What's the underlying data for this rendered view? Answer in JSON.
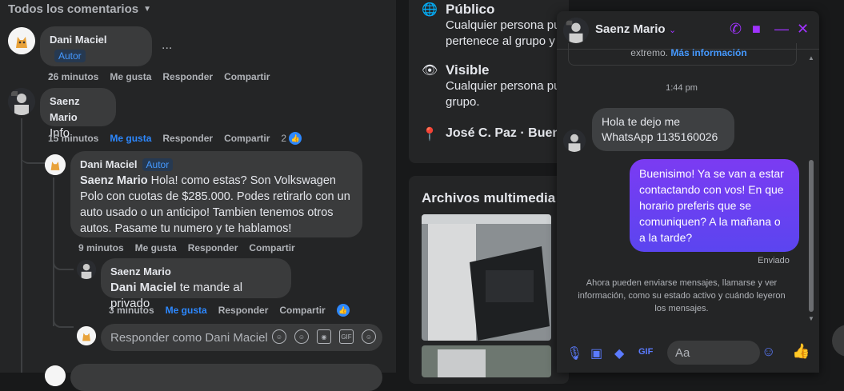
{
  "left": {
    "sort_label": "Todos los comentarios",
    "comments": [
      {
        "author": "Dani Maciel",
        "badge": "Autor",
        "text": ".",
        "time": "26 minutos",
        "like": "Me gusta",
        "reply": "Responder",
        "share": "Compartir"
      },
      {
        "author": "Saenz Mario",
        "text": "Info",
        "time": "15 minutos",
        "like": "Me gusta",
        "reply": "Responder",
        "share": "Compartir",
        "like_count": "2"
      },
      {
        "author": "Dani Maciel",
        "badge": "Autor",
        "mention": "Saenz Mario",
        "text": " Hola! como estas? Son Volkswagen Polo con cuotas de $285.000. Podes retirarlo con un auto usado o un anticipo! Tambien tenemos otros autos. Pasame tu numero y te hablamos!",
        "time": "9 minutos",
        "like": "Me gusta",
        "reply": "Responder",
        "share": "Compartir"
      },
      {
        "author": "Saenz Mario",
        "mention": "Dani Maciel",
        "text": " te mande al privado",
        "time": "3 minutos",
        "like": "Me gusta",
        "reply": "Responder",
        "share": "Compartir"
      }
    ],
    "reply_placeholder": "Responder como Dani Maciel",
    "more": "..."
  },
  "right": {
    "info": [
      {
        "title": "Público",
        "desc": "Cualquier persona pu",
        "desc2": "pertenece al grupo y",
        "icon": "globe-icon"
      },
      {
        "title": "Visible",
        "desc": "Cualquier persona pu",
        "desc2": "grupo.",
        "icon": "eye-icon"
      },
      {
        "title": "José C. Paz · Buen",
        "icon": "location-icon"
      }
    ],
    "media_title": "Archivos multimedia r"
  },
  "chat": {
    "name": "Saenz Mario",
    "notice": "extremo.",
    "notice_link": "Más información",
    "time": "1:44 pm",
    "incoming": "Hola te dejo me WhatsApp 1135160026",
    "outgoing": "Buenisimo! Ya se van a estar contactando con vos! En que horario preferis que se comuniquen? A la mañana o a la tarde?",
    "sent": "Enviado",
    "footer": "Ahora pueden enviarse mensajes, llamarse y ver información, como su estado activo y cuándo leyeron los mensajes.",
    "composer_placeholder": "Aa"
  },
  "colors": {
    "accent": "#2d88ff",
    "messenger": "#a033ff",
    "bg": "#18191a"
  }
}
